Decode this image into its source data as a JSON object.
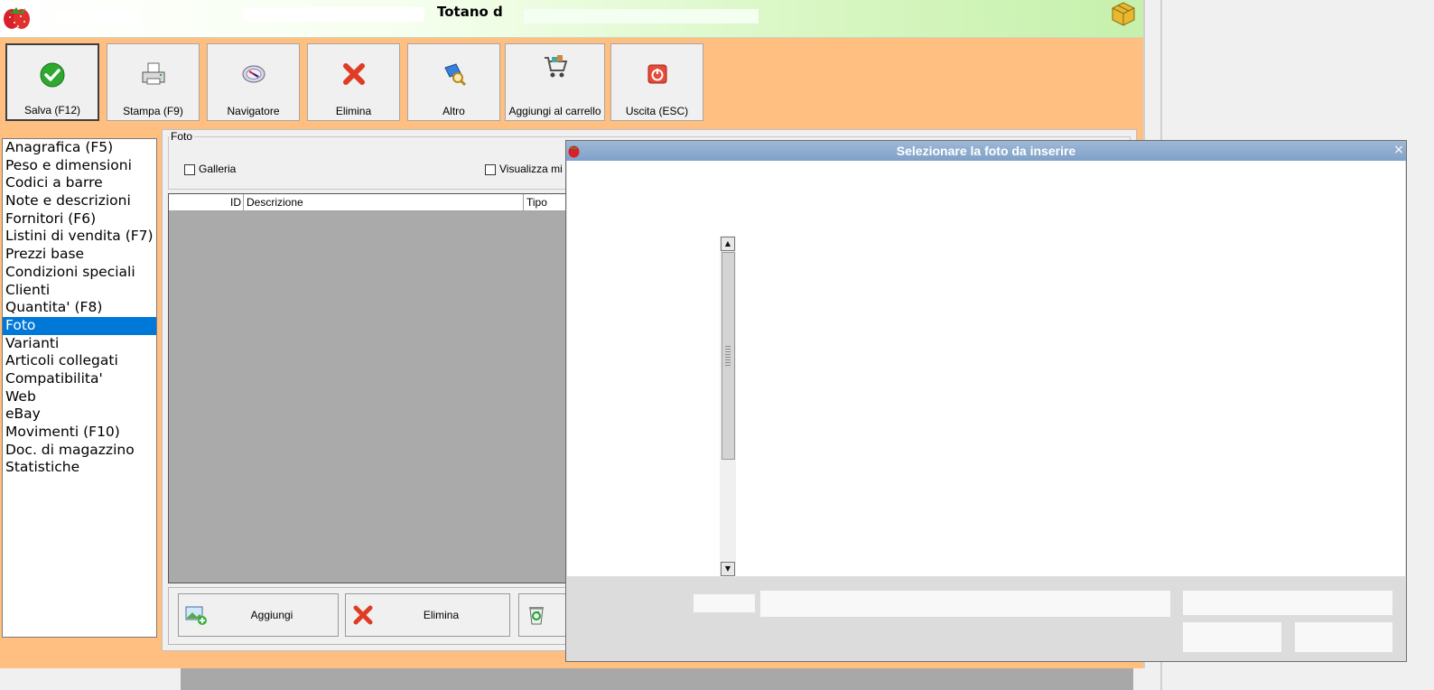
{
  "window": {
    "title": "Totano d"
  },
  "toolbar": {
    "buttons": [
      {
        "label": "Salva (F12)"
      },
      {
        "label": "Stampa (F9)"
      },
      {
        "label": "Navigatore"
      },
      {
        "label": "Elimina"
      },
      {
        "label": "Altro"
      },
      {
        "label": "Aggiungi al carrello"
      },
      {
        "label": "Uscita (ESC)"
      }
    ]
  },
  "sidebar": {
    "items": [
      {
        "label": "Anagrafica (F5)"
      },
      {
        "label": "Peso e dimensioni"
      },
      {
        "label": "Codici a barre"
      },
      {
        "label": "Note e descrizioni"
      },
      {
        "label": "Fornitori (F6)"
      },
      {
        "label": "Listini di vendita (F7)"
      },
      {
        "label": "Prezzi base"
      },
      {
        "label": "Condizioni speciali"
      },
      {
        "label": "Clienti"
      },
      {
        "label": "Quantita' (F8)"
      },
      {
        "label": "Foto"
      },
      {
        "label": "Varianti"
      },
      {
        "label": "Articoli collegati"
      },
      {
        "label": "Compatibilita'"
      },
      {
        "label": "Web"
      },
      {
        "label": "eBay"
      },
      {
        "label": "Movimenti (F10)"
      },
      {
        "label": "Doc. di magazzino"
      },
      {
        "label": "Statistiche"
      }
    ],
    "selected": "Foto"
  },
  "foto": {
    "group_label": "Foto",
    "galleria_label": "Galleria",
    "visualizza_label": "Visualizza mi",
    "columns": [
      "ID",
      "Descrizione",
      "Tipo"
    ],
    "add_label": "Aggiungi",
    "delete_label": "Elimina"
  },
  "dialog": {
    "title": "Selezionare la foto da inserire",
    "close_symbol": "×"
  },
  "colors": {
    "window_bg": "#ffbf80",
    "selection": "#0078d7",
    "dialog_title": "#7fa1c8"
  }
}
